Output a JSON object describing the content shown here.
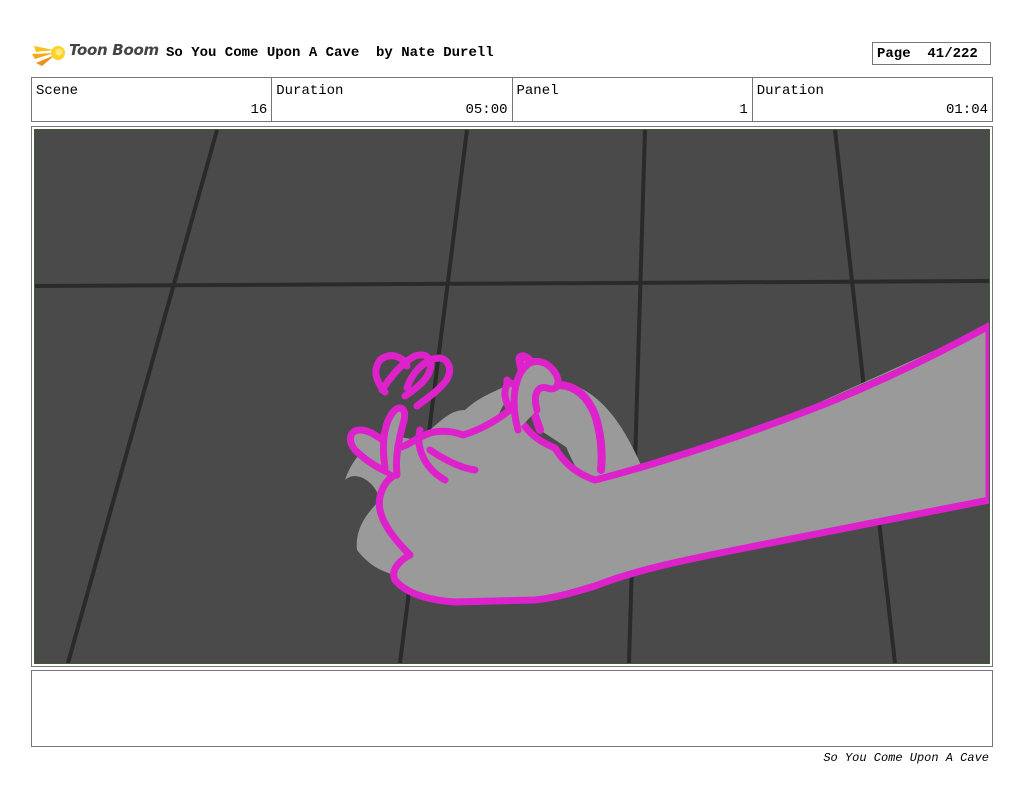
{
  "header": {
    "brand": "Toon Boom",
    "title": "So You Come Upon A Cave  by Nate Durell",
    "page": "Page  41/222"
  },
  "info": {
    "scene_label": "Scene",
    "scene_value": "16",
    "scene_duration_label": "Duration",
    "scene_duration_value": "05:00",
    "panel_label": "Panel",
    "panel_value": "1",
    "panel_duration_label": "Duration",
    "panel_duration_value": "01:04"
  },
  "panel": {
    "floor_color": "#4a4a4a",
    "grid_line_color": "#2a2a2a",
    "hand_fill_color": "#9a9a9a",
    "hand_outline_color": "#dd22cc"
  },
  "notes": "",
  "footer": "So You Come Upon A Cave"
}
